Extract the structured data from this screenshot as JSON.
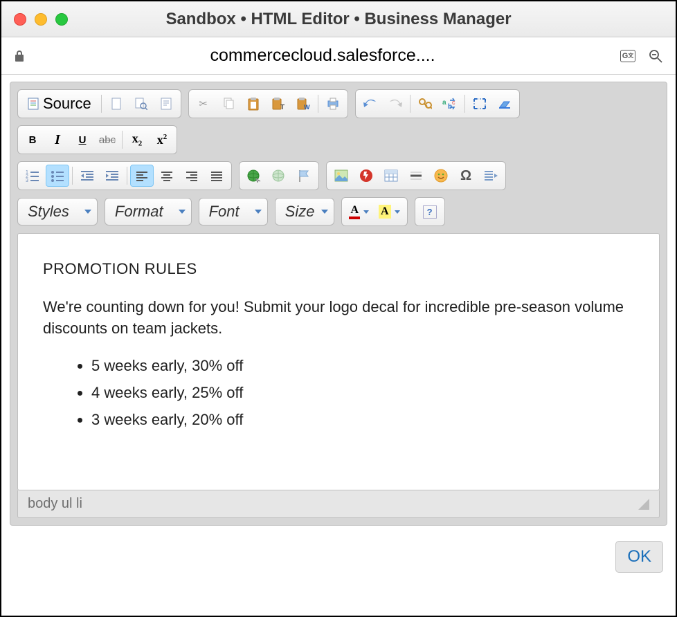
{
  "window": {
    "title": "Sandbox • HTML Editor • Business Manager"
  },
  "url": {
    "text": "commercecloud.salesforce...."
  },
  "toolbar": {
    "source_label": "Source",
    "combos": {
      "styles": "Styles",
      "format": "Format",
      "font": "Font",
      "size": "Size"
    }
  },
  "content": {
    "heading": "PROMOTION RULES",
    "paragraph": "We're counting down for you! Submit your logo decal for incredible pre-season volume discounts on team jackets.",
    "items": [
      "5 weeks early, 30% off",
      "4 weeks early, 25% off",
      "3 weeks early, 20% off"
    ]
  },
  "status": {
    "path": "body  ul  li"
  },
  "footer": {
    "ok": "OK"
  }
}
